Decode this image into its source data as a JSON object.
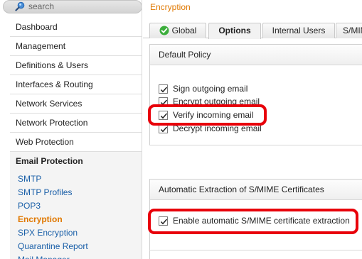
{
  "search": {
    "placeholder": "search",
    "value": ""
  },
  "sidebar": {
    "items": [
      {
        "label": "Dashboard"
      },
      {
        "label": "Management"
      },
      {
        "label": "Definitions & Users"
      },
      {
        "label": "Interfaces & Routing"
      },
      {
        "label": "Network Services"
      },
      {
        "label": "Network Protection"
      },
      {
        "label": "Web Protection"
      }
    ],
    "section": {
      "label": "Email Protection"
    },
    "subitems": [
      {
        "label": "SMTP"
      },
      {
        "label": "SMTP Profiles"
      },
      {
        "label": "POP3"
      },
      {
        "label": "Encryption",
        "active": true
      },
      {
        "label": "SPX Encryption"
      },
      {
        "label": "Quarantine Report"
      },
      {
        "label": "Mail Manager"
      }
    ]
  },
  "page": {
    "title": "Encryption"
  },
  "tabs": [
    {
      "label": "Global",
      "icon": "check-circle-icon",
      "status_color": "#3cae3c"
    },
    {
      "label": "Options",
      "active": true
    },
    {
      "label": "Internal Users"
    },
    {
      "label": "S/MIME"
    }
  ],
  "default_policy": {
    "title": "Default Policy",
    "options": [
      {
        "label": "Sign outgoing email",
        "checked": true
      },
      {
        "label": "Encrypt outgoing email",
        "checked": true
      },
      {
        "label": "Verify incoming email",
        "checked": true,
        "highlighted": true
      },
      {
        "label": "Decrypt incoming email",
        "checked": true
      }
    ]
  },
  "extraction": {
    "title": "Automatic Extraction of S/MIME Certificates",
    "option": {
      "label": "Enable automatic S/MIME certificate extraction",
      "checked": true,
      "highlighted": true
    }
  },
  "colors": {
    "accent": "#e07800",
    "link": "#1a5fa8",
    "highlight": "#e8000a"
  }
}
